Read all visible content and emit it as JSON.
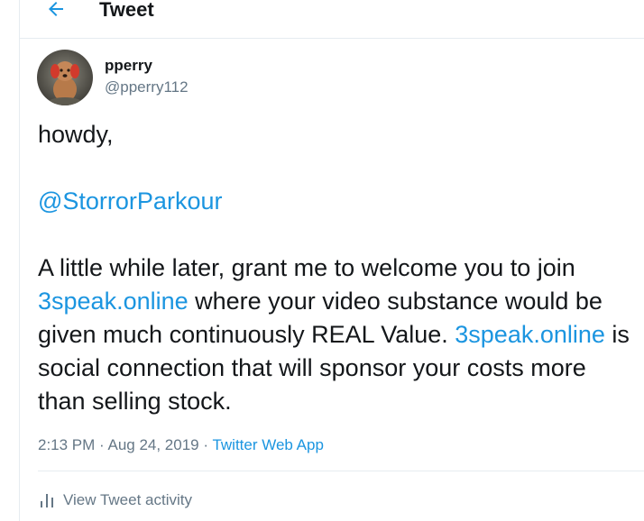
{
  "header": {
    "title": "Tweet",
    "back_icon": "arrow-left-icon"
  },
  "author": {
    "name": "pperry",
    "handle": "@pperry112",
    "avatar": "avatar-dog-photo"
  },
  "tweet": {
    "line1": "howdy,",
    "mention": "@StorrorParkour",
    "line3_start": "A little while later, grant me to welcome you to join",
    "link1": "3speak.online",
    "line4_rest": " where your video substance would be",
    "line5_start": "given much continuously REAL Value. ",
    "link2": "3speak.online",
    "line5_end": " is",
    "line6": "social connection that will sponsor your costs more",
    "line7": "than selling stock."
  },
  "meta": {
    "time": "2:13 PM",
    "sep1": " · ",
    "date": "Aug 24, 2019",
    "sep2": " · ",
    "app": "Twitter Web App"
  },
  "activity": {
    "label": "View Tweet activity",
    "icon": "bar-chart-icon"
  },
  "colors": {
    "link": "#1b95e0",
    "secondary_text": "#657786",
    "primary_text": "#14171a",
    "border": "#e6ecf0"
  }
}
